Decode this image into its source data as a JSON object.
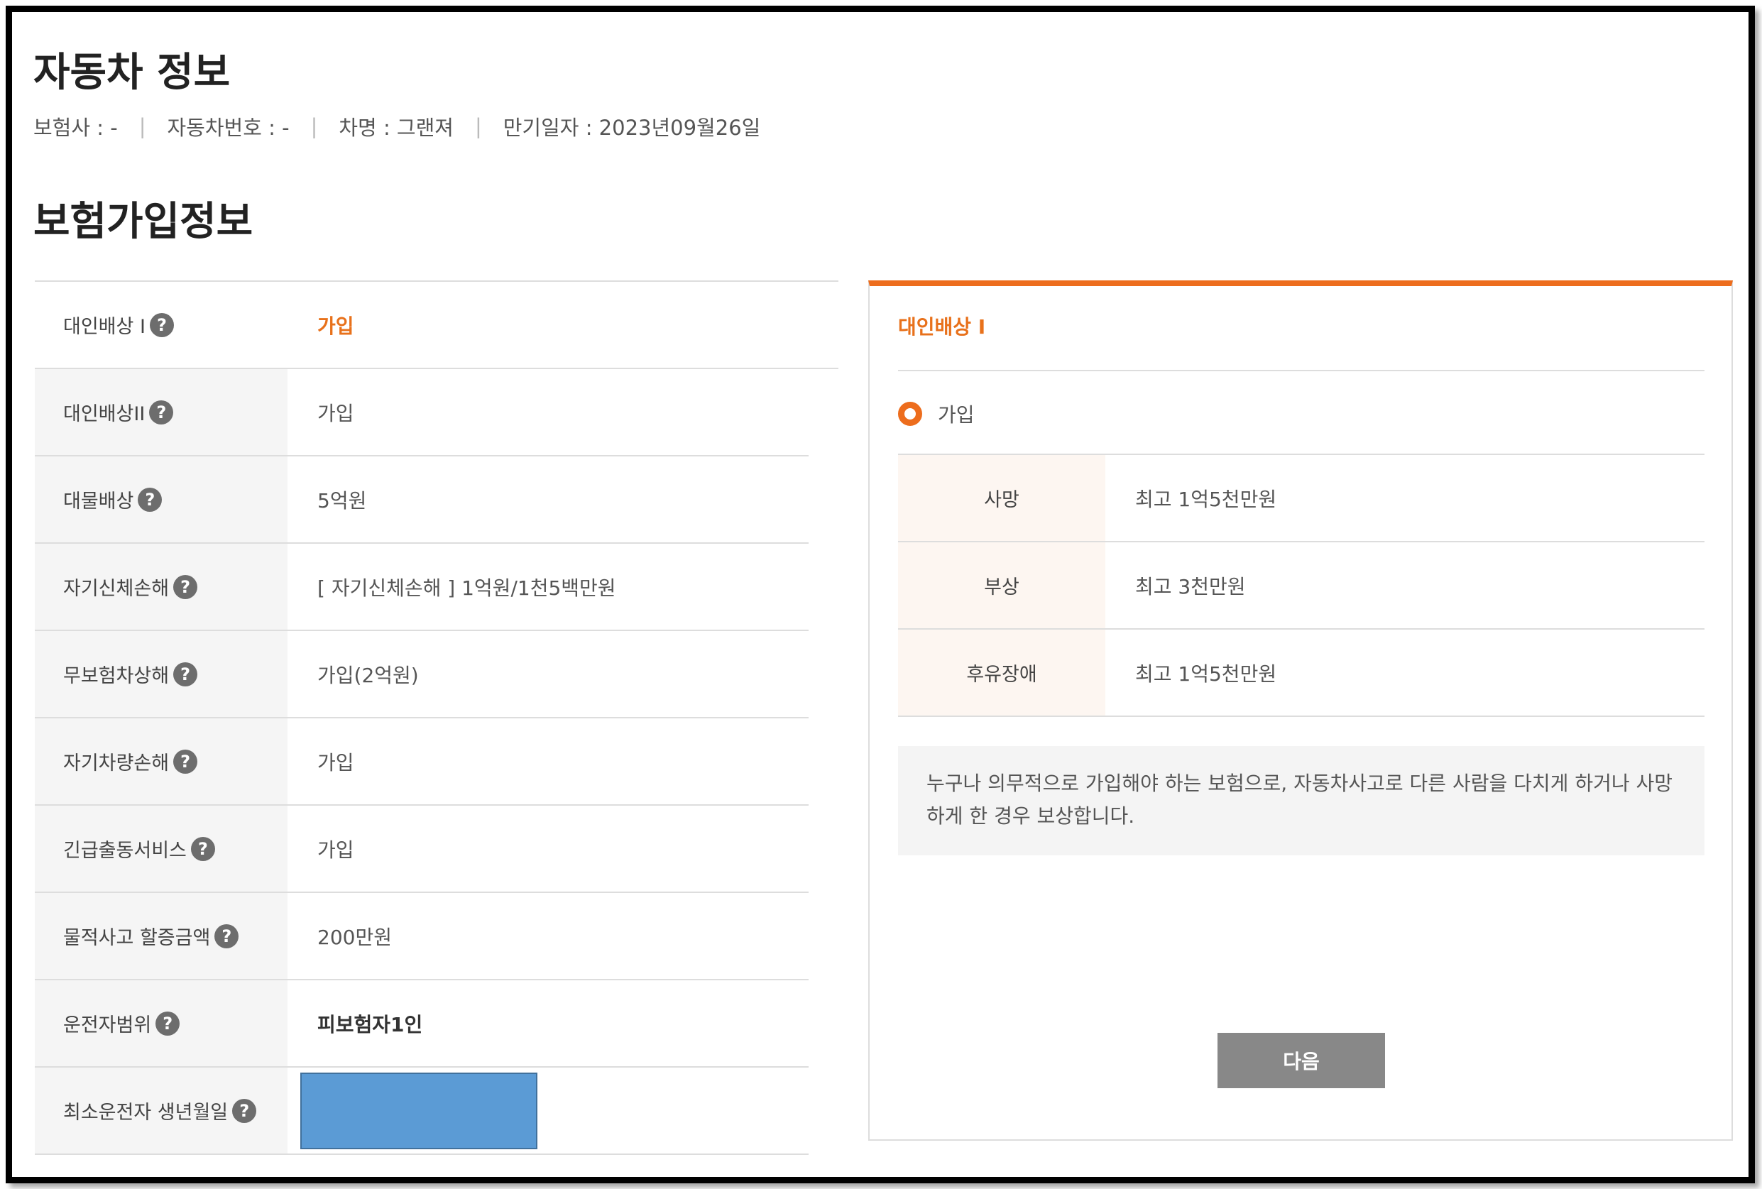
{
  "car_info": {
    "title": "자동차 정보",
    "insurer": "보험사 : -",
    "car_number": "자동차번호 : -",
    "car_name": "차명 : 그랜져",
    "expiry": "만기일자 : 2023년09월26일"
  },
  "insurance": {
    "title": "보험가입정보",
    "rows": [
      {
        "label": "대인배상 I",
        "value": "가입"
      },
      {
        "label": "대인배상II",
        "value": "가입"
      },
      {
        "label": "대물배상",
        "value": "5억원"
      },
      {
        "label": "자기신체손해",
        "value": "[ 자기신체손해 ] 1억원/1천5백만원"
      },
      {
        "label": "무보험차상해",
        "value": "가입(2억원)"
      },
      {
        "label": "자기차량손해",
        "value": "가입"
      },
      {
        "label": "긴급출동서비스",
        "value": "가입"
      },
      {
        "label": "물적사고 할증금액",
        "value": "200만원"
      },
      {
        "label": "운전자범위",
        "value": "피보험자1인"
      },
      {
        "label": "최소운전자 생년월일",
        "value": ""
      }
    ]
  },
  "detail": {
    "title": "대인배상 I",
    "option": "가입",
    "coverage": [
      {
        "key": "사망",
        "value": "최고 1억5천만원"
      },
      {
        "key": "부상",
        "value": "최고 3천만원"
      },
      {
        "key": "후유장애",
        "value": "최고 1억5천만원"
      }
    ],
    "description": "누구나 의무적으로 가입해야 하는 보험으로, 자동차사고로 다른 사람을 다치게 하거나 사망하게 한 경우 보상합니다.",
    "next_label": "다음"
  },
  "colors": {
    "accent": "#ed6d1d",
    "redaction": "#5b9bd5",
    "button": "#888888"
  }
}
